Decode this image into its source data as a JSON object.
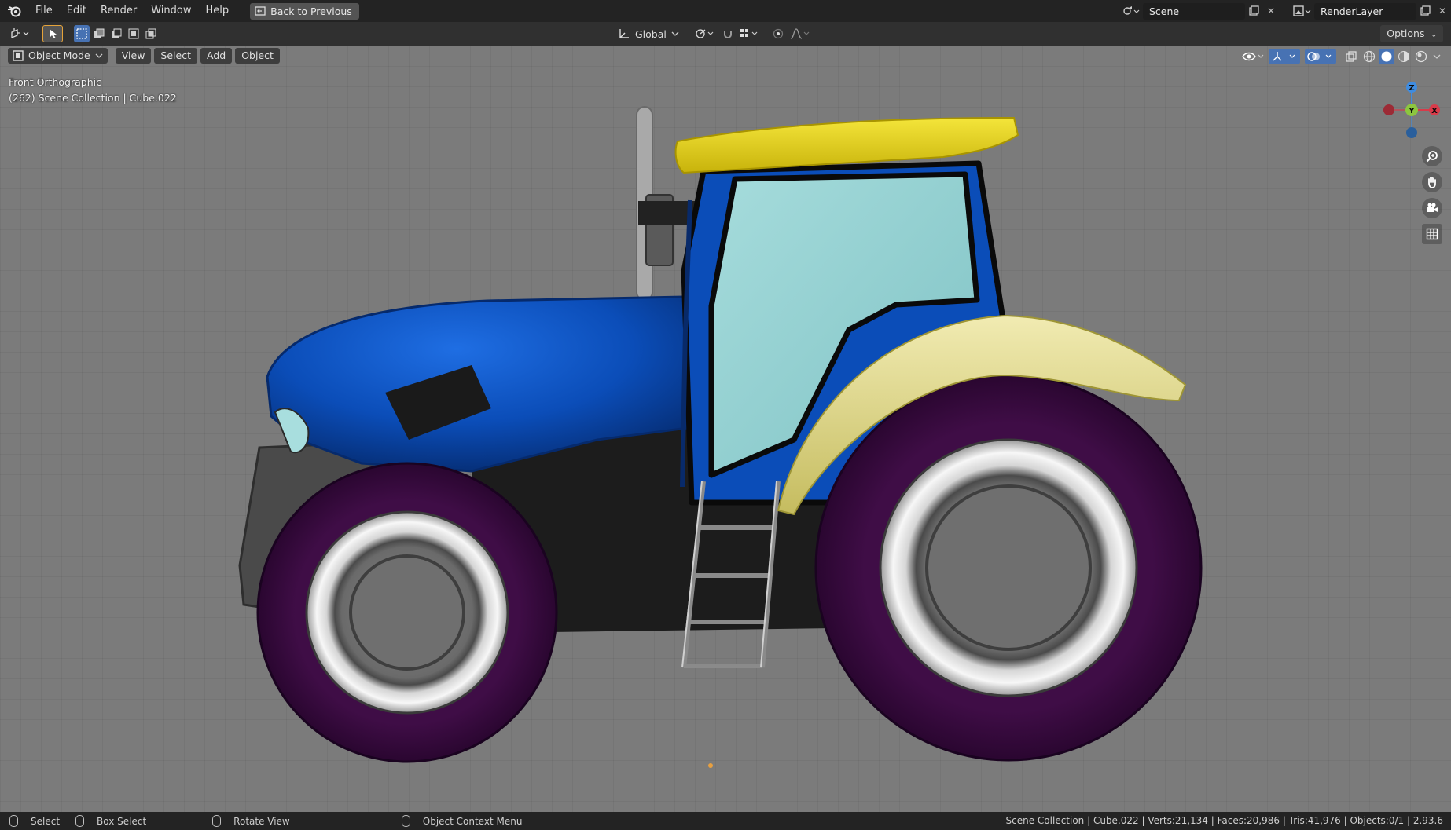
{
  "topbar": {
    "menus": [
      "File",
      "Edit",
      "Render",
      "Window",
      "Help"
    ],
    "back_button": "Back to Previous",
    "scene_name": "Scene",
    "view_layer": "RenderLayer"
  },
  "toolbar": {
    "transform_orientation": "Global",
    "options_label": "Options"
  },
  "viewport": {
    "mode": "Object Mode",
    "menus": [
      "View",
      "Select",
      "Add",
      "Object"
    ],
    "view_name": "Front Orthographic",
    "collection_info": "(262) Scene Collection | Cube.022",
    "gizmo_axes": {
      "z": "Z",
      "y": "Y",
      "x": "X"
    }
  },
  "statusbar": {
    "select": "Select",
    "box_select": "Box Select",
    "rotate_view": "Rotate View",
    "context_menu": "Object Context Menu",
    "stats": "Scene Collection | Cube.022 | Verts:21,134 | Faces:20,986 | Tris:41,976 | Objects:0/1 | 2.93.6"
  },
  "colors": {
    "accent": "#4772b3",
    "axis_x": "#d83b4a",
    "axis_y": "#8cc63f",
    "axis_z": "#3f8ce0",
    "tractor_body": "#0b4db8",
    "roof": "#e5d21a",
    "fender": "#e2d98a",
    "tire": "#3a0b3f",
    "glass": "#8fcfd0"
  }
}
